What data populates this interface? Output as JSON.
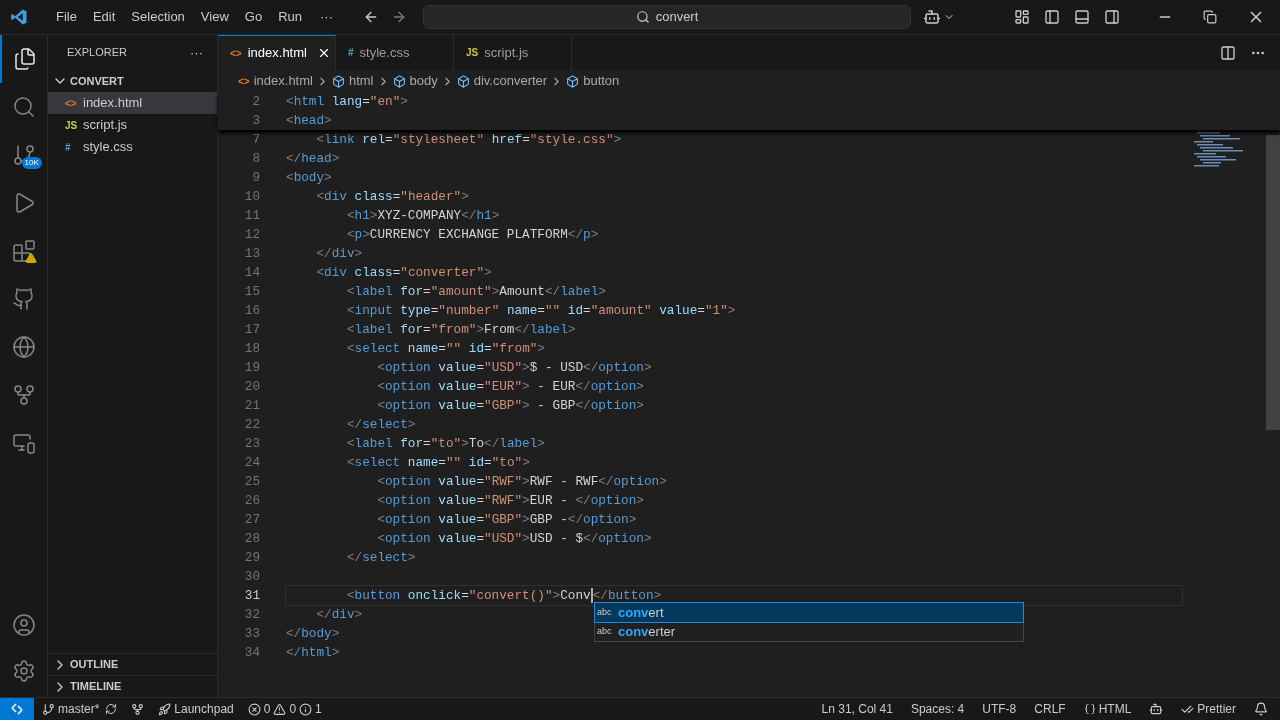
{
  "title_bar": {
    "menus": [
      "File",
      "Edit",
      "Selection",
      "View",
      "Go",
      "Run"
    ],
    "more": "···",
    "search": {
      "value": "convert"
    }
  },
  "activity_bar": {
    "items": [
      {
        "kind": "files",
        "selected": true
      },
      {
        "kind": "search",
        "selected": false
      },
      {
        "kind": "source-control",
        "selected": false,
        "badge": "10K"
      },
      {
        "kind": "run",
        "selected": false
      },
      {
        "kind": "extensions",
        "selected": false,
        "warning": true
      },
      {
        "kind": "github",
        "selected": false
      },
      {
        "kind": "browser",
        "selected": false
      },
      {
        "kind": "git-graph",
        "selected": false
      },
      {
        "kind": "remote",
        "selected": false
      }
    ]
  },
  "sidebar": {
    "title": "EXPLORER",
    "more": "···",
    "folder": {
      "name": "CONVERT",
      "expanded": true
    },
    "files": [
      {
        "name": "index.html",
        "color": "#e37933",
        "icon_text": "<>",
        "selected": true
      },
      {
        "name": "script.js",
        "color": "#cbcb41",
        "icon_text": "JS",
        "selected": false
      },
      {
        "name": "style.css",
        "color": "#519aba",
        "icon_text": "#",
        "selected": false
      }
    ],
    "sections": [
      {
        "name": "OUTLINE",
        "expanded": false
      },
      {
        "name": "TIMELINE",
        "expanded": false
      }
    ]
  },
  "tabs": [
    {
      "name": "index.html",
      "color": "#e37933",
      "icon_text": "<>",
      "selected": true
    },
    {
      "name": "style.css",
      "color": "#519aba",
      "icon_text": "#",
      "selected": false
    },
    {
      "name": "script.js",
      "color": "#cbcb41",
      "icon_text": "JS",
      "selected": false
    }
  ],
  "breadcrumb": [
    {
      "kind": "file",
      "icon_text": "<>",
      "label": "index.html"
    },
    {
      "kind": "element",
      "label": "html"
    },
    {
      "kind": "element",
      "label": "body"
    },
    {
      "kind": "element",
      "label": "div.converter"
    },
    {
      "kind": "element",
      "label": "button"
    }
  ],
  "sticky_lines": [
    {
      "number": "2",
      "text": "<html lang=\"en\">"
    },
    {
      "number": "3",
      "text": "<head>"
    }
  ],
  "lines": [
    {
      "number": "7",
      "text": "    <link rel=\"stylesheet\" href=\"style.css\">"
    },
    {
      "number": "8",
      "text": "</head>"
    },
    {
      "number": "9",
      "text": "<body>"
    },
    {
      "number": "10",
      "text": "    <div class=\"header\">"
    },
    {
      "number": "11",
      "text": "        <h1>XYZ-COMPANY</h1>"
    },
    {
      "number": "12",
      "text": "        <p>CURRENCY EXCHANGE PLATFORM</p>"
    },
    {
      "number": "13",
      "text": "    </div>"
    },
    {
      "number": "14",
      "text": "    <div class=\"converter\">"
    },
    {
      "number": "15",
      "text": "        <label for=\"amount\">Amount</label>"
    },
    {
      "number": "16",
      "text": "        <input type=\"number\" name=\"\" id=\"amount\" value=\"1\">"
    },
    {
      "number": "17",
      "text": "        <label for=\"from\">From</label>"
    },
    {
      "number": "18",
      "text": "        <select name=\"\" id=\"from\">"
    },
    {
      "number": "19",
      "text": "            <option value=\"USD\">$ - USD</option>"
    },
    {
      "number": "20",
      "text": "            <option value=\"EUR\"> - EUR</option>"
    },
    {
      "number": "21",
      "text": "            <option value=\"GBP\"> - GBP</option>"
    },
    {
      "number": "22",
      "text": "        </select>"
    },
    {
      "number": "23",
      "text": "        <label for=\"to\">To</label>"
    },
    {
      "number": "24",
      "text": "        <select name=\"\" id=\"to\">"
    },
    {
      "number": "25",
      "text": "            <option value=\"RWF\">RWF - RWF</option>"
    },
    {
      "number": "26",
      "text": "            <option value=\"RWF\">EUR - </option>"
    },
    {
      "number": "27",
      "text": "            <option value=\"GBP\">GBP -</option>"
    },
    {
      "number": "28",
      "text": "            <option value=\"USD\">USD - $</option>"
    },
    {
      "number": "29",
      "text": "        </select>"
    },
    {
      "number": "30"
    },
    {
      "number": "31",
      "text": "        <button onclick=\"convert()\">Conv",
      "after_cursor": "</button>",
      "current": true
    },
    {
      "number": "32",
      "text": "    </div>"
    },
    {
      "number": "33",
      "text": "</body>"
    },
    {
      "number": "34",
      "text": "</html>"
    }
  ],
  "suggestions": [
    {
      "icon_text": "abc",
      "match": "conv",
      "rest": "ert",
      "selected": true
    },
    {
      "icon_text": "abc",
      "match": "conv",
      "rest": "erter",
      "selected": false
    }
  ],
  "status_bar": {
    "branch": "master*",
    "launchpad": "Launchpad",
    "errors": "0",
    "warnings": "0",
    "infos": "1",
    "right": [
      {
        "kind": "text",
        "label": "Ln 31, Col 41"
      },
      {
        "kind": "text",
        "label": "Spaces: 4"
      },
      {
        "kind": "text",
        "label": "UTF-8"
      },
      {
        "kind": "text",
        "label": "CRLF"
      },
      {
        "kind": "language",
        "label": "HTML"
      },
      {
        "kind": "copilot"
      },
      {
        "kind": "prettier",
        "label": "Prettier"
      },
      {
        "kind": "bell"
      }
    ]
  }
}
